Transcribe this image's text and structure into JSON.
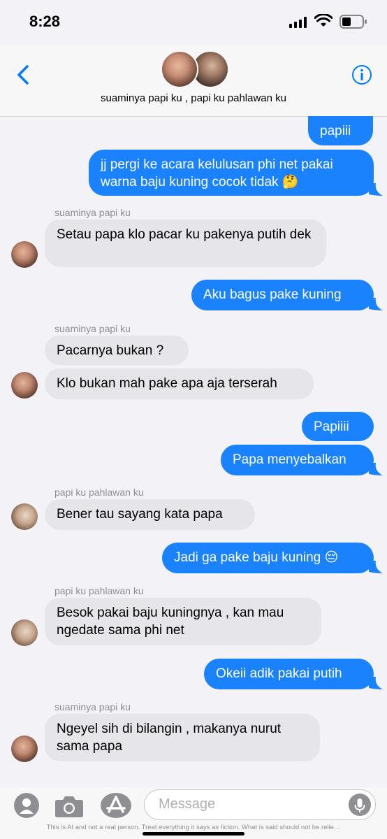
{
  "status_bar": {
    "time": "8:28"
  },
  "header": {
    "title": "suaminya papi ku , papi ku pahlawan ku"
  },
  "messages": [
    {
      "text": "papiii"
    },
    {
      "text": "jj pergi ke acara kelulusan phi net pakai warna baju kuning cocok tidak 🤔"
    },
    {
      "sender": "suaminya papi ku",
      "text": "Setau papa klo pacar ku pakenya putih dek"
    },
    {
      "text": "Aku bagus pake kuning"
    },
    {
      "sender": "suaminya papi ku",
      "text": "Pacarnya bukan ?"
    },
    {
      "text": "Klo bukan mah pake apa aja terserah"
    },
    {
      "text": "Papiiii"
    },
    {
      "text": "Papa menyebalkan"
    },
    {
      "sender": "papi ku pahlawan ku",
      "text": "Bener tau sayang kata papa"
    },
    {
      "text": "Jadi ga pake baju kuning 😔"
    },
    {
      "sender": "papi ku pahlawan ku",
      "text": "Besok pakai baju kuningnya , kan mau ngedate sama phi net"
    },
    {
      "text": "Okeii adik pakai putih"
    },
    {
      "sender": "suaminya papi ku",
      "text": "Ngeyel sih di bilangin , makanya nurut sama papa"
    }
  ],
  "input": {
    "placeholder": "Message"
  },
  "footer": {
    "disclaimer": "This is AI and not a real person. Treat everything it says as fiction. What is said should not be relie…"
  },
  "icons": [
    "back-chevron-icon",
    "info-icon",
    "contacts-icon",
    "camera-icon",
    "app-store-icon",
    "microphone-icon"
  ],
  "colors": {
    "outgoing": "#1982fc",
    "incoming": "#e5e5ea",
    "accent": "#007aff"
  }
}
